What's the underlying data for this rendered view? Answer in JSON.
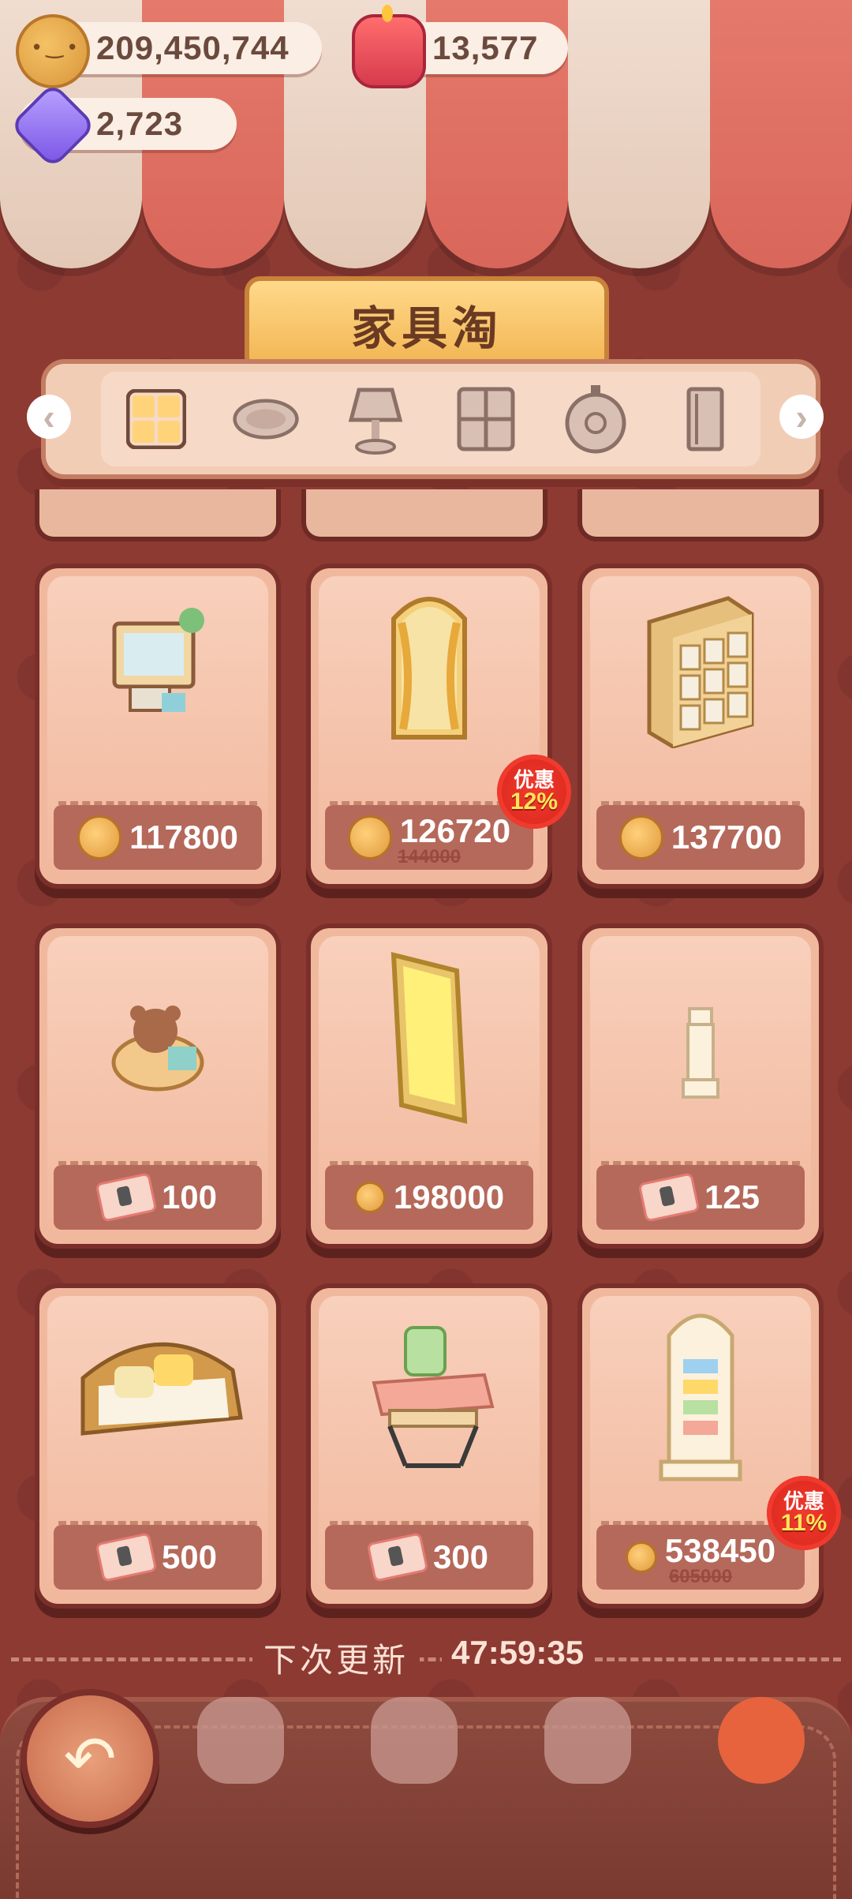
{
  "currencies": {
    "cookies": "209,450,744",
    "candles": "13,577",
    "crystals": "2,723"
  },
  "title": "家具淘",
  "categories": [
    {
      "icon": "grid-icon"
    },
    {
      "icon": "rug-icon"
    },
    {
      "icon": "lamp-icon"
    },
    {
      "icon": "window-icon"
    },
    {
      "icon": "wall-clock-icon"
    },
    {
      "icon": "door-icon"
    }
  ],
  "items": [
    {
      "name": "tv-stand",
      "currency": "cookie",
      "price": "117800"
    },
    {
      "name": "curtain-door",
      "currency": "cookie",
      "price": "126720",
      "old_price": "144000",
      "badge_label": "优惠",
      "badge_pct": "12%"
    },
    {
      "name": "locker-cabinet",
      "currency": "cookie",
      "price": "137700"
    },
    {
      "name": "teddy-basket",
      "currency": "ticket",
      "price": "100"
    },
    {
      "name": "golden-window",
      "currency": "cookie",
      "price": "198000"
    },
    {
      "name": "white-pillar",
      "currency": "ticket",
      "price": "125"
    },
    {
      "name": "ornate-sofa",
      "currency": "ticket",
      "price": "500"
    },
    {
      "name": "sewing-table",
      "currency": "ticket",
      "price": "300"
    },
    {
      "name": "bookshelf-cabinet",
      "currency": "cookie",
      "price": "538450",
      "old_price": "605000",
      "badge_label": "优惠",
      "badge_pct": "11%"
    }
  ],
  "refresh": {
    "label": "下次更新",
    "time": "47:59:35"
  },
  "colors": {
    "background": "#8d3a33",
    "card": "#f0b99e",
    "price_bar": "#b5695a",
    "badge": "#f03a2e"
  }
}
